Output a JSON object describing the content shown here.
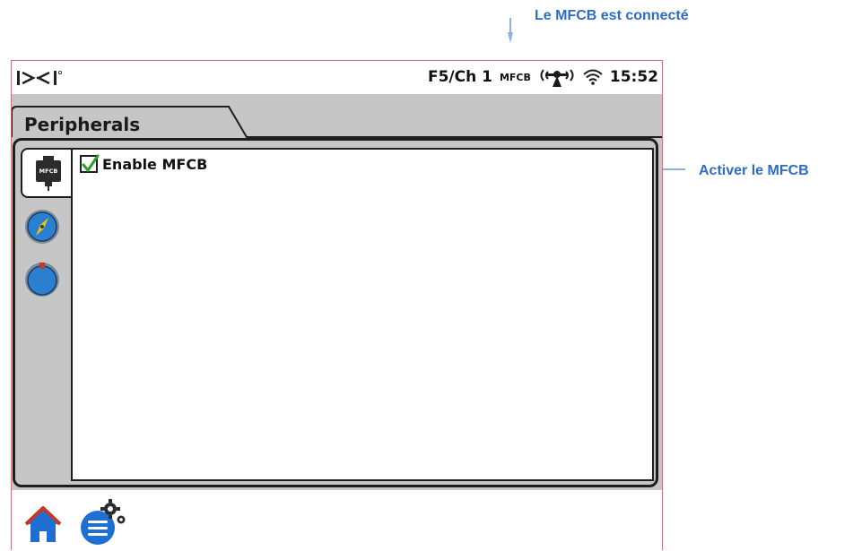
{
  "annotations": {
    "connected": "Le MFCB est connecté",
    "enable": "Activer le MFCB"
  },
  "statusbar": {
    "brand": "DCI",
    "channel": "F5/Ch 1",
    "mfcb": "MFCB",
    "time": "15:52",
    "icons": [
      "dci-logo",
      "antenna-icon",
      "wifi-icon"
    ]
  },
  "page": {
    "tab_title": "Peripherals"
  },
  "sidebar": {
    "items": [
      {
        "name": "mfcb-device-icon",
        "label": "MFCB",
        "selected": true
      },
      {
        "name": "compass-icon",
        "selected": false
      },
      {
        "name": "gauge-icon",
        "selected": false
      }
    ]
  },
  "settings": {
    "enable_mfcb": {
      "label": "Enable MFCB",
      "checked": true
    }
  },
  "bottombar": {
    "icons": [
      "home-icon",
      "settings-menu-icon"
    ]
  },
  "colors": {
    "annotation": "#2e6cc2",
    "frame": "#c9707a",
    "checkmark": "#2a9d2a",
    "home": "#1e6fd1"
  }
}
